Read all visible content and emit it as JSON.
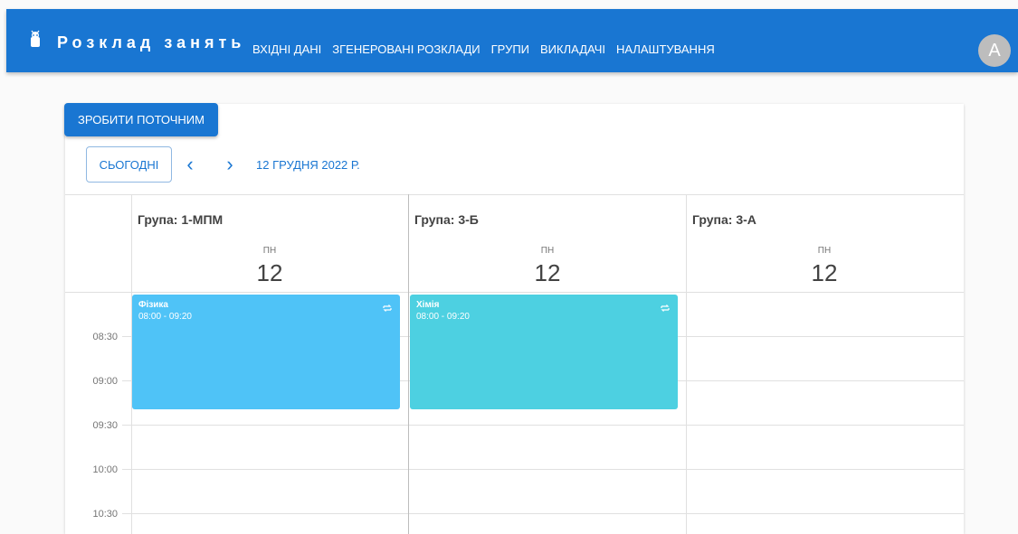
{
  "header": {
    "brand": "Розклад занять",
    "nav": [
      "ВХІДНІ ДАНІ",
      "ЗГЕНЕРОВАНІ РОЗКЛАДИ",
      "ГРУПИ",
      "ВИКЛАДАЧІ",
      "НАЛАШТУВАННЯ"
    ],
    "avatar_letter": "A"
  },
  "toolbar": {
    "make_current": "ЗРОБИТИ ПОТОЧНИМ",
    "today": "СЬОГОДНІ",
    "prev_icon": "chevron-left-icon",
    "next_icon": "chevron-right-icon",
    "date": "12 ГРУДНЯ 2022 Р."
  },
  "columns": [
    {
      "group": "Група: 1-МПМ",
      "day_name": "ПН",
      "day_num": "12"
    },
    {
      "group": "Група: 3-Б",
      "day_name": "ПН",
      "day_num": "12"
    },
    {
      "group": "Група: 3-А",
      "day_name": "ПН",
      "day_num": "12"
    }
  ],
  "times": [
    "08:30",
    "09:00",
    "09:30",
    "10:00",
    "10:30"
  ],
  "events": [
    {
      "title": "Фізика",
      "time": "08:00 - 09:20",
      "color": "#4fc3f7",
      "icon": "repeat-icon"
    },
    {
      "title": "Хімія",
      "time": "08:00 - 09:20",
      "color": "#4dd0e1",
      "icon": "repeat-icon"
    }
  ],
  "colors": {
    "primary": "#1976d2"
  }
}
